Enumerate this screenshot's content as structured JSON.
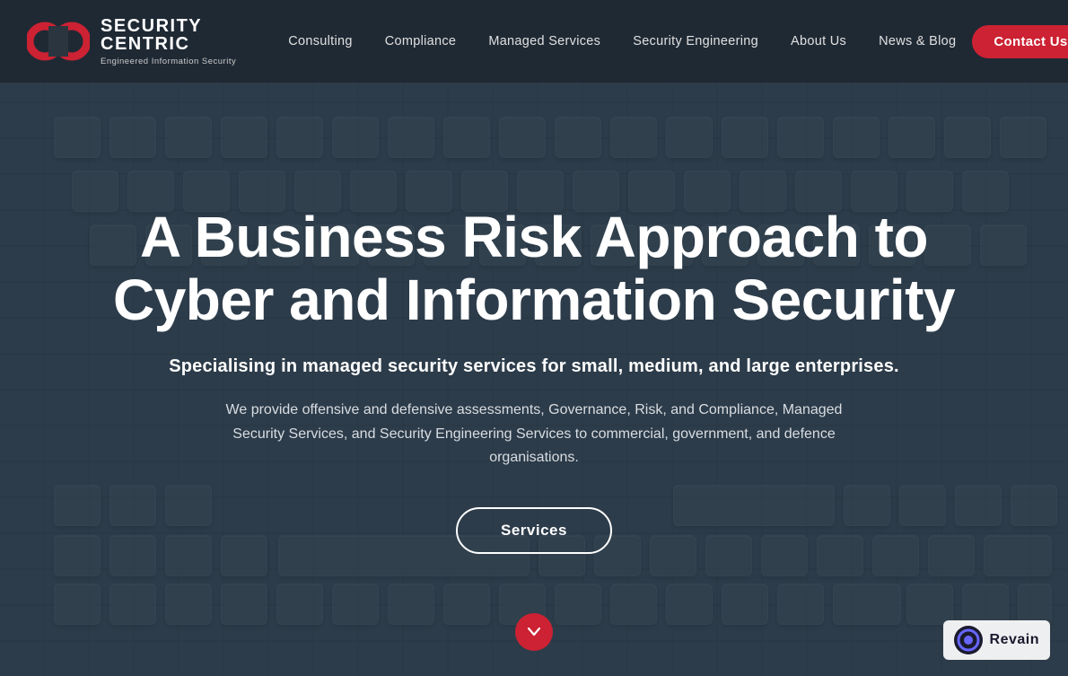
{
  "logo": {
    "name_line1": "SECURITY",
    "name_line2": "CENTRIC",
    "tagline": "Engineered Information Security"
  },
  "nav": {
    "links": [
      {
        "label": "Consulting",
        "id": "consulting"
      },
      {
        "label": "Compliance",
        "id": "compliance"
      },
      {
        "label": "Managed Services",
        "id": "managed-services"
      },
      {
        "label": "Security Engineering",
        "id": "security-engineering"
      },
      {
        "label": "About Us",
        "id": "about-us"
      },
      {
        "label": "News & Blog",
        "id": "news-blog"
      }
    ],
    "contact_label": "Contact Us"
  },
  "hero": {
    "title": "A Business Risk Approach to Cyber and Information Security",
    "subtitle": "Specialising in managed security services for small, medium, and large enterprises.",
    "description": "We provide offensive and defensive assessments, Governance, Risk, and Compliance, Managed Security Services, and Security Engineering Services to commercial, government, and defence organisations.",
    "services_button": "Services"
  },
  "scroll_down_icon": "chevron-down",
  "revain": {
    "label": "Revain"
  },
  "colors": {
    "accent_red": "#cc2233",
    "nav_bg": "rgba(30,40,50,0.92)",
    "overlay": "rgba(40,55,68,0.72)"
  }
}
